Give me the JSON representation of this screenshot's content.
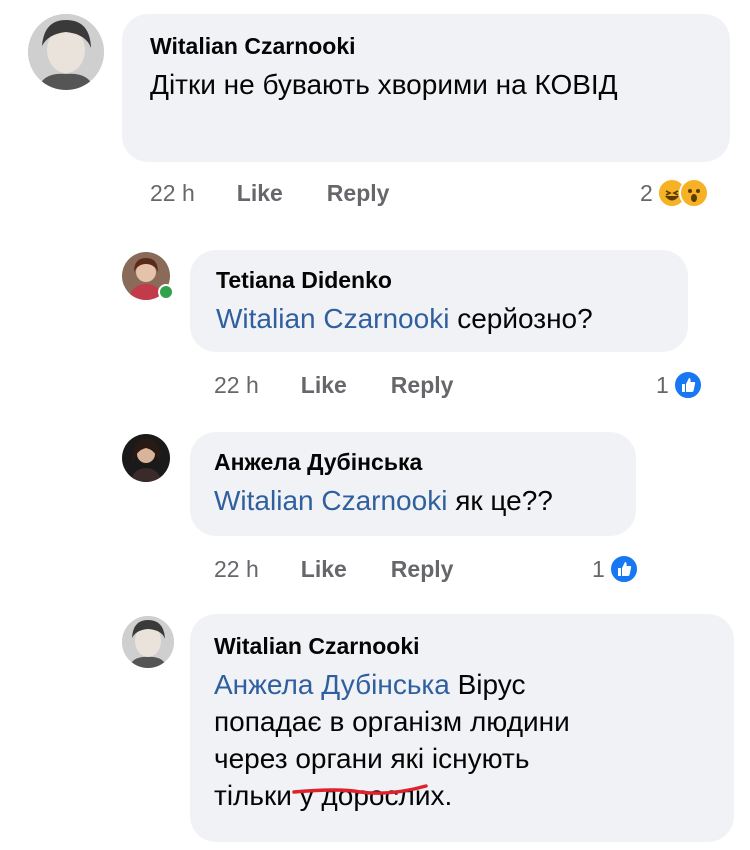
{
  "comments": [
    {
      "author": "Witalian Czarnooki",
      "mention": "",
      "text": "Дітки не бувають хворими на КОВІД",
      "time": "22 h",
      "like": "Like",
      "reply": "Reply",
      "reaction_count": "2",
      "reactions": [
        "haha-icon",
        "wow-icon"
      ]
    },
    {
      "author": "Tetiana Didenko",
      "mention": "Witalian Czarnooki",
      "text": "серйозно?",
      "time": "22 h",
      "like": "Like",
      "reply": "Reply",
      "reaction_count": "1",
      "reactions": [
        "like-icon"
      ]
    },
    {
      "author": "Анжела Дубінська",
      "mention": "Witalian Czarnooki",
      "text": "як це??",
      "time": "22 h",
      "like": "Like",
      "reply": "Reply",
      "reaction_count": "1",
      "reactions": [
        "like-icon"
      ]
    },
    {
      "author": "Witalian Czarnooki",
      "mention": "Анжела Дубінська",
      "text_line1": "Вірус",
      "text_line2": "попадає в організм людини",
      "text_line3_a": "через ",
      "text_line3_b": "органи",
      "text_line3_c": " які існують",
      "text_line4": "тільки у дорослих."
    }
  ],
  "colors": {
    "bubble": "#f0f2f5",
    "mention": "#2f5f9e",
    "meta": "#65676b",
    "underline": "#e0202a",
    "like_blue": "#1877f2",
    "online": "#31a24c"
  }
}
